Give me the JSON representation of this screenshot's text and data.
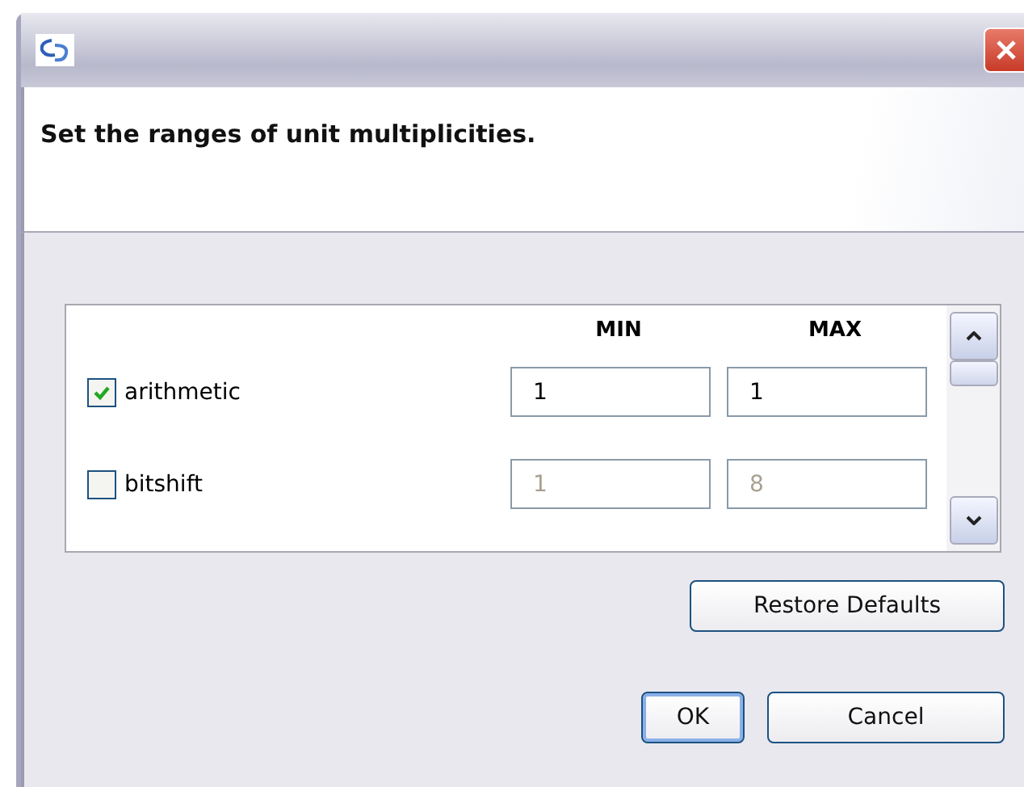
{
  "header": {
    "message": "Set the ranges of unit multiplicities."
  },
  "table": {
    "columns": [
      "MIN",
      "MAX"
    ],
    "rows": [
      {
        "name": "arithmetic",
        "checked": true,
        "min": "1",
        "max": "1",
        "disabled": false
      },
      {
        "name": "bitshift",
        "checked": false,
        "min": "1",
        "max": "8",
        "disabled": true
      }
    ]
  },
  "buttons": {
    "restore": "Restore Defaults",
    "ok": "OK",
    "cancel": "Cancel"
  }
}
